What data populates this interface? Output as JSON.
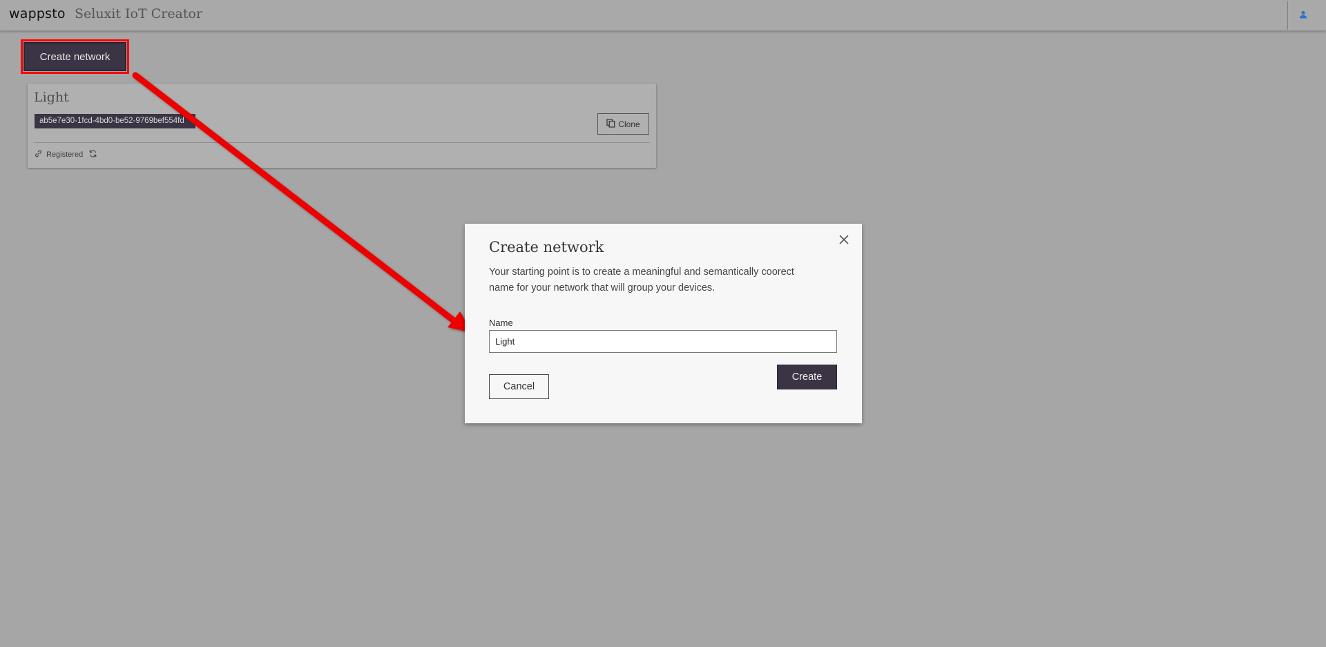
{
  "header": {
    "brand": "wappsto",
    "title": "Seluxit IoT Creator",
    "user_icon": "user-icon"
  },
  "toolbar": {
    "create_network_label": "Create network"
  },
  "network_card": {
    "title": "Light",
    "id": "ab5e7e30-1fcd-4bd0-be52-9769bef554fd",
    "clone_label": "Clone",
    "status": "Registered"
  },
  "modal": {
    "title": "Create network",
    "description": "Your starting point is to create a meaningful and semantically coorect name for your network that will group your devices.",
    "name_label": "Name",
    "name_value": "Light",
    "cancel_label": "Cancel",
    "create_label": "Create"
  },
  "colors": {
    "overlay_bg": "#a6a6a6",
    "primary_button": "#3b3444",
    "annotation": "#ff0000",
    "user_icon": "#2a73c9"
  }
}
